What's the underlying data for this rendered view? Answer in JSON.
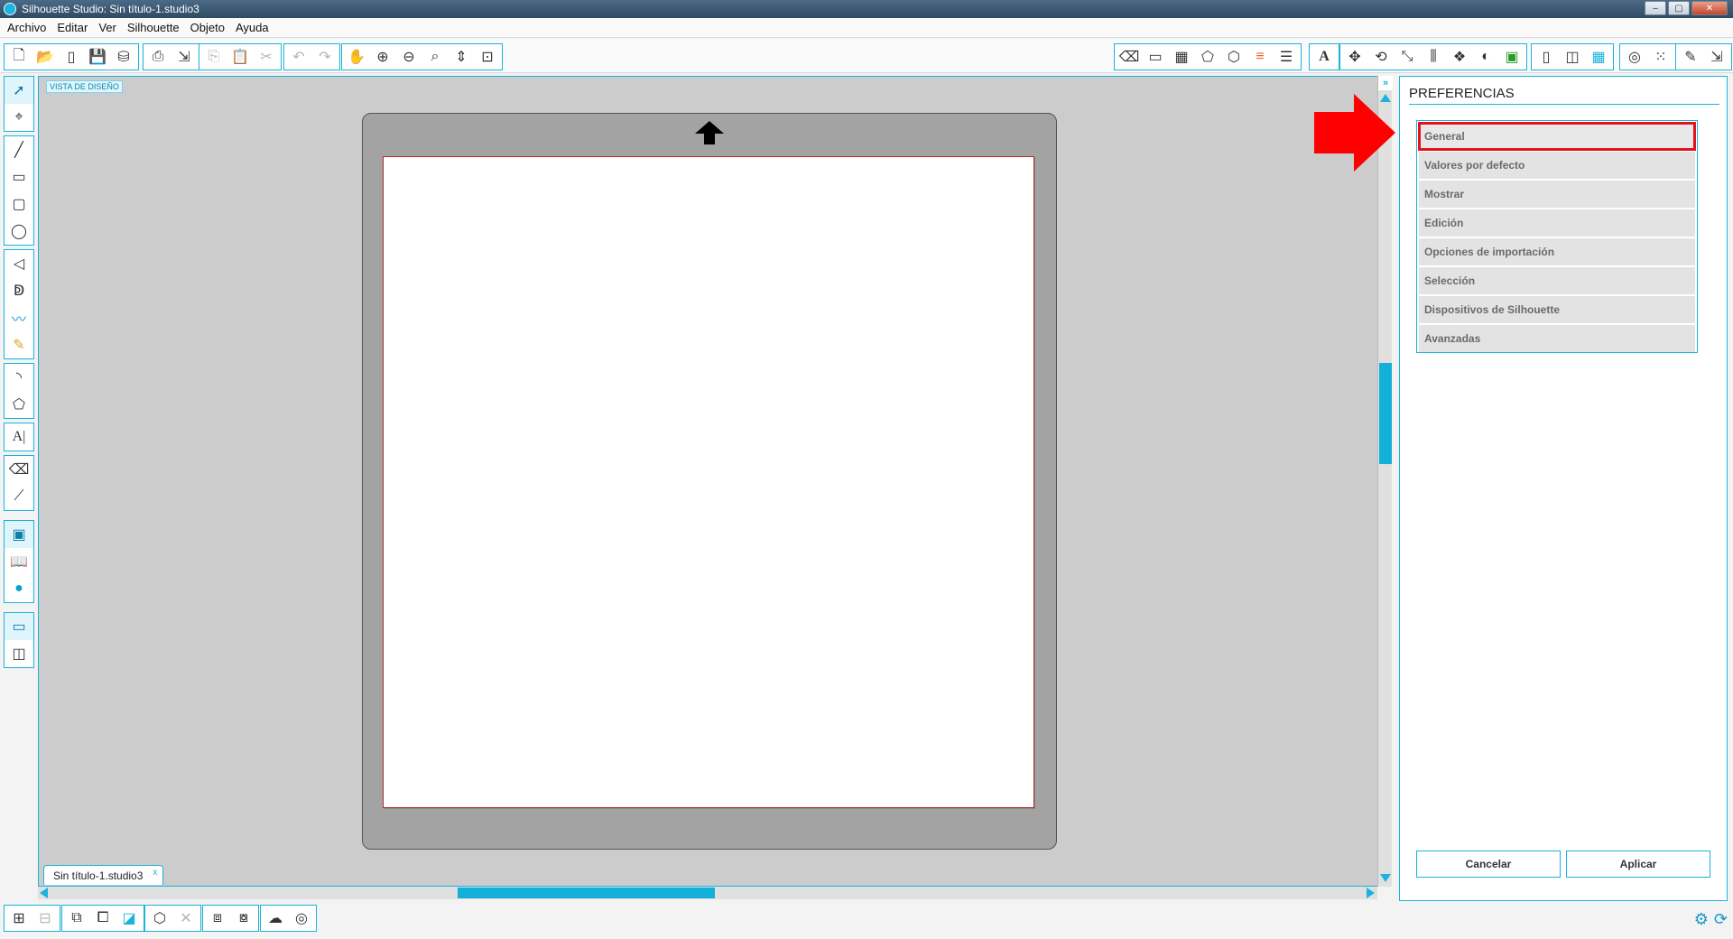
{
  "window": {
    "title": "Silhouette Studio: Sin título-1.studio3",
    "controls": [
      "–",
      "▢",
      "✕"
    ]
  },
  "menubar": {
    "items": [
      "Archivo",
      "Editar",
      "Ver",
      "Silhouette",
      "Objeto",
      "Ayuda"
    ]
  },
  "toolbar": {
    "left_icons": [
      "new-file-icon",
      "open-file-icon",
      "new-page-icon",
      "save-icon",
      "save-library-icon",
      "print-icon",
      "send-cut-icon",
      "copy-icon",
      "paste-icon",
      "cut-icon",
      "undo-icon",
      "redo-icon",
      "pan-hand-icon",
      "zoom-in-icon",
      "zoom-out-icon",
      "zoom-select-icon",
      "zoom-drag-icon",
      "fit-page-icon"
    ],
    "right_icons": [
      "clear-fill-icon",
      "page-setup-icon",
      "grid-settings-icon",
      "registration-icon",
      "offset-icon",
      "line-color-icon",
      "line-style-icon",
      "text-style-icon",
      "transform-icon",
      "rotate-icon",
      "scale-icon",
      "align-icon",
      "replicate-icon",
      "modify-icon",
      "trace-icon",
      "fill-color-icon",
      "pages-icon",
      "cut-settings-icon",
      "grid-icon",
      "knife-icon",
      "points-icon",
      "design-store-icon",
      "send-icon"
    ]
  },
  "left_tools": {
    "group1": [
      "select-icon",
      "point-edit-icon"
    ],
    "group2": [
      "line-icon",
      "rectangle-icon",
      "rounded-rectangle-icon",
      "ellipse-icon"
    ],
    "group3": [
      "polygon-icon",
      "curve-icon",
      "freehand-icon",
      "smooth-freehand-icon"
    ],
    "group4": [
      "arc-icon",
      "regular-polygon-icon"
    ],
    "group5": [
      "text-icon"
    ],
    "group6": [
      "eraser-icon",
      "knife-icon"
    ],
    "group7": [
      "design-view-icon",
      "library-icon",
      "silhouette-store-icon"
    ],
    "group8": [
      "single-view-icon",
      "split-view-icon"
    ]
  },
  "canvas": {
    "view_label": "VISTA DE DISEÑO",
    "document_tab": "Sin título-1.studio3",
    "tab_close": "x"
  },
  "preferences_panel": {
    "title": "PREFERENCIAS",
    "items": [
      {
        "label": "General",
        "selected": true
      },
      {
        "label": "Valores por defecto",
        "selected": false
      },
      {
        "label": "Mostrar",
        "selected": false
      },
      {
        "label": "Edición",
        "selected": false
      },
      {
        "label": "Opciones de importación",
        "selected": false
      },
      {
        "label": "Selección",
        "selected": false
      },
      {
        "label": "Dispositivos de Silhouette",
        "selected": false
      },
      {
        "label": "Avanzadas",
        "selected": false
      }
    ],
    "cancel_label": "Cancelar",
    "apply_label": "Aplicar"
  },
  "bottom_toolbar": {
    "icons": [
      "group-icon",
      "ungroup-icon",
      "compound-path-icon",
      "release-compound-icon",
      "make-compound-icon",
      "weld-icon",
      "erase-icon",
      "bring-front-icon",
      "send-back-icon",
      "merge-icon",
      "offset-rings-icon"
    ]
  },
  "status": {
    "icons": [
      "settings-gear-icon",
      "refresh-icon"
    ]
  },
  "colors": {
    "accent": "#19b3db",
    "highlight": "#e8101a",
    "mat": "#a3a3a3",
    "canvas_bg": "#cccccc"
  }
}
